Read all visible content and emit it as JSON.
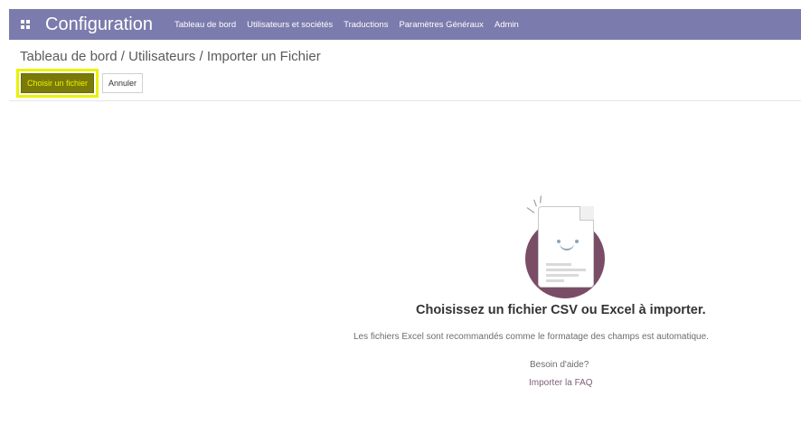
{
  "navbar": {
    "brand": "Configuration",
    "menu": [
      {
        "label": "Tableau de bord"
      },
      {
        "label": "Utilisateurs et sociétés"
      },
      {
        "label": "Traductions"
      },
      {
        "label": "Paramètres Généraux"
      },
      {
        "label": "Admin"
      }
    ],
    "apps_icon": "grid-icon"
  },
  "breadcrumb": {
    "items": [
      "Tableau de bord",
      "Utilisateurs",
      "Importer un Fichier"
    ],
    "separator": "/"
  },
  "actions": {
    "choose_file_label": "Choisir un fichier",
    "cancel_label": "Annuler"
  },
  "empty_state": {
    "illustration": "document-smiley-icon",
    "title": "Choisissez un fichier CSV ou Excel à importer.",
    "subtitle": "Les fichiers Excel sont recommandés comme le formatage des champs est automatique.",
    "help_text": "Besoin d'aide?",
    "faq_link": "Importer la FAQ"
  },
  "colors": {
    "navbar": "#7c7bad",
    "highlight": "#e9f200",
    "primary_button_bg": "#7a7a0a",
    "illustration_circle": "#7a4d67",
    "link": "#7c5f78"
  }
}
